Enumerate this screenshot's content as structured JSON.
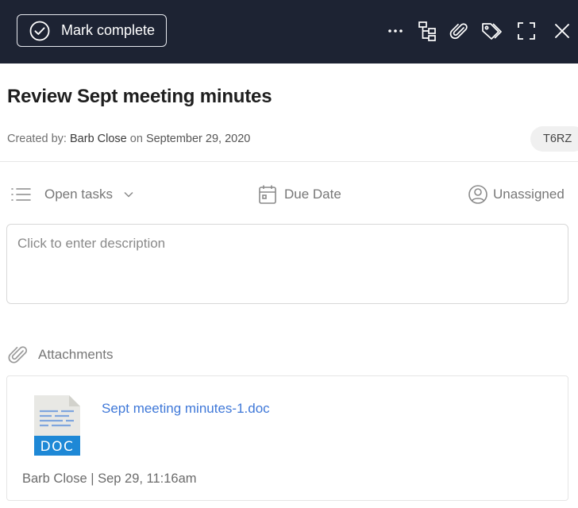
{
  "toolbar": {
    "mark_complete_label": "Mark complete",
    "bg_color": "#1d2333",
    "icons": [
      "more-icon",
      "subtasks-icon",
      "attach-icon",
      "tags-icon",
      "fullscreen-icon",
      "close-icon"
    ]
  },
  "task": {
    "title": "Review Sept meeting minutes",
    "created_by_prefix": "Created by:",
    "created_by": "Barb Close",
    "created_on_prefix": "on",
    "created_date": "September 29, 2020",
    "code": "T6RZ"
  },
  "properties": {
    "list_label": "Open tasks",
    "due_date_label": "Due Date",
    "assignee_label": "Unassigned"
  },
  "description": {
    "placeholder": "Click to enter description"
  },
  "attachments": {
    "heading": "Attachments",
    "items": [
      {
        "file_type": "DOC",
        "file_name": "Sept meeting minutes-1.doc",
        "uploaded_info": "Barb Close | Sep 29, 11:16am"
      }
    ]
  },
  "colors": {
    "link": "#3f78d8",
    "doc_badge": "#1e88d6"
  }
}
